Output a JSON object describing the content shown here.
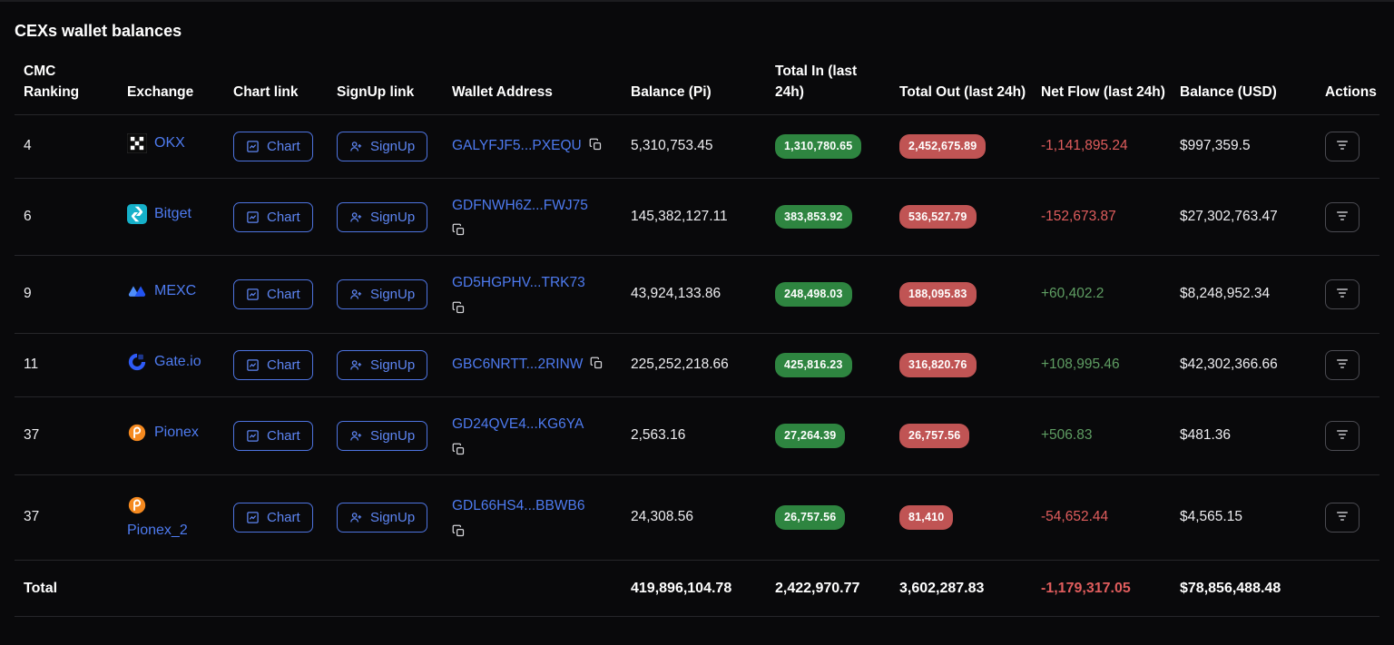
{
  "page": {
    "title": "CEXs wallet balances"
  },
  "colors": {
    "accent_blue": "#4e7bf0",
    "badge_green": "#2e8540",
    "badge_red": "#c05454",
    "negative_red": "#e05d5d",
    "positive_green": "#5f9e63"
  },
  "table": {
    "headers": {
      "cmc_ranking": "CMC Ranking",
      "exchange": "Exchange",
      "chart_link": "Chart link",
      "signup_link": "SignUp link",
      "wallet_address": "Wallet Address",
      "balance_pi": "Balance (Pi)",
      "total_in": "Total In (last 24h)",
      "total_out": "Total Out (last 24h)",
      "net_flow": "Net Flow (last 24h)",
      "balance_usd": "Balance (USD)",
      "actions": "Actions"
    },
    "buttons": {
      "chart": "Chart",
      "signup": "SignUp"
    },
    "rows": [
      {
        "rank": "4",
        "exchange": "OKX",
        "wallet": "GALYFJF5...PXEQU",
        "balance_pi": "5,310,753.45",
        "total_in": "1,310,780.65",
        "total_out": "2,452,675.89",
        "net_flow": "-1,141,895.24",
        "net_flow_status": "negative",
        "balance_usd": "$997,359.5"
      },
      {
        "rank": "6",
        "exchange": "Bitget",
        "wallet": "GDFNWH6Z...FWJ75",
        "balance_pi": "145,382,127.11",
        "total_in": "383,853.92",
        "total_out": "536,527.79",
        "net_flow": "-152,673.87",
        "net_flow_status": "negative",
        "balance_usd": "$27,302,763.47"
      },
      {
        "rank": "9",
        "exchange": "MEXC",
        "wallet": "GD5HGPHV...TRK73",
        "balance_pi": "43,924,133.86",
        "total_in": "248,498.03",
        "total_out": "188,095.83",
        "net_flow": "+60,402.2",
        "net_flow_status": "positive",
        "balance_usd": "$8,248,952.34"
      },
      {
        "rank": "11",
        "exchange": "Gate.io",
        "wallet": "GBC6NRTT...2RINW",
        "balance_pi": "225,252,218.66",
        "total_in": "425,816.23",
        "total_out": "316,820.76",
        "net_flow": "+108,995.46",
        "net_flow_status": "positive",
        "balance_usd": "$42,302,366.66"
      },
      {
        "rank": "37",
        "exchange": "Pionex",
        "wallet": "GD24QVE4...KG6YA",
        "balance_pi": "2,563.16",
        "total_in": "27,264.39",
        "total_out": "26,757.56",
        "net_flow": "+506.83",
        "net_flow_status": "positive",
        "balance_usd": "$481.36"
      },
      {
        "rank": "37",
        "exchange": "Pionex_2",
        "wallet": "GDL66HS4...BBWB6",
        "balance_pi": "24,308.56",
        "total_in": "26,757.56",
        "total_out": "81,410",
        "net_flow": "-54,652.44",
        "net_flow_status": "negative",
        "balance_usd": "$4,565.15"
      }
    ],
    "total": {
      "label": "Total",
      "balance_pi": "419,896,104.78",
      "total_in": "2,422,970.77",
      "total_out": "3,602,287.83",
      "net_flow": "-1,179,317.05",
      "net_flow_status": "negative",
      "balance_usd": "$78,856,488.48"
    }
  }
}
